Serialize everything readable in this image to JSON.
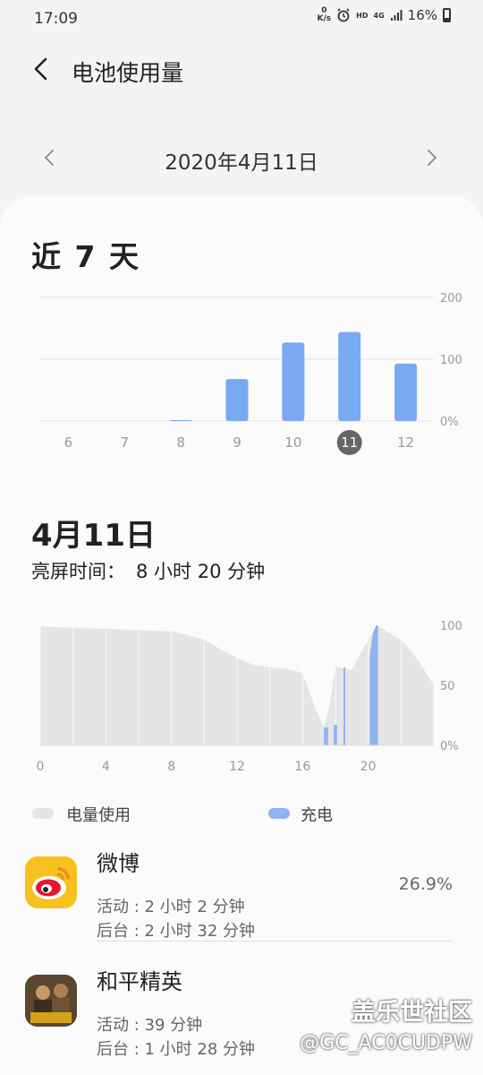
{
  "status": {
    "time": "17:09",
    "net_speed_value": "0",
    "net_speed_unit": "K/s",
    "hd": "HD",
    "network": "4G",
    "battery": "16%"
  },
  "header": {
    "title": "电池使用量"
  },
  "date_nav": {
    "date": "2020年4月11日"
  },
  "weekly": {
    "title": "近 7 天"
  },
  "daily": {
    "title": "4月11日",
    "screen_on_label": "亮屏时间：",
    "screen_on_value": "8 小时 20 分钟"
  },
  "legend": {
    "usage": "电量使用",
    "charging": "充电"
  },
  "apps": [
    {
      "name": "微博",
      "active": "活动 : 2 小时 2 分钟",
      "background": "后台 : 2 小时 32 分钟",
      "percent": "26.9%"
    },
    {
      "name": "和平精英",
      "active": "活动 : 39 分钟",
      "background": "后台 : 1 小时 28 分钟",
      "percent": ""
    }
  ],
  "watermark": {
    "line1": "盖乐世社区",
    "line2": "@GC_AC0CUDPW"
  },
  "colors": {
    "bar": "#78a9f2",
    "usage_area": "#e5e5e5",
    "charging": "#8eb3ef",
    "selected_day": "#666666"
  },
  "chart_data": [
    {
      "type": "bar",
      "categories": [
        "6",
        "7",
        "8",
        "9",
        "10",
        "11",
        "12"
      ],
      "values": [
        0,
        0,
        1,
        68,
        127,
        144,
        93
      ],
      "selected": "11",
      "y_ticks": [
        "200",
        "100",
        "0%"
      ],
      "ylim": [
        0,
        200
      ],
      "grid": true
    },
    {
      "type": "area",
      "x_ticks": [
        "0",
        "4",
        "8",
        "12",
        "16",
        "20"
      ],
      "y_ticks": [
        "100",
        "50",
        "0%"
      ],
      "xlim": [
        0,
        24
      ],
      "ylim": [
        0,
        100
      ],
      "series": [
        {
          "name": "电量使用",
          "x": [
            0,
            2,
            4,
            6,
            8,
            9,
            10,
            11,
            12,
            13,
            14,
            15,
            16,
            16.8,
            17.3,
            17.6,
            18,
            18.5,
            19,
            20,
            20.5,
            21,
            22,
            23,
            24
          ],
          "y": [
            99,
            98,
            97,
            96,
            95,
            92,
            88,
            80,
            73,
            67,
            65,
            64,
            60,
            30,
            15,
            30,
            66,
            64,
            63,
            88,
            100,
            96,
            88,
            72,
            50
          ]
        },
        {
          "name": "充电",
          "x": [
            17.3,
            17.6,
            17.9,
            18.2,
            18.5,
            20.1,
            20.3,
            20.5,
            20.6
          ],
          "y": [
            15,
            15,
            17,
            25,
            65,
            75,
            94,
            100,
            100
          ]
        }
      ]
    }
  ]
}
